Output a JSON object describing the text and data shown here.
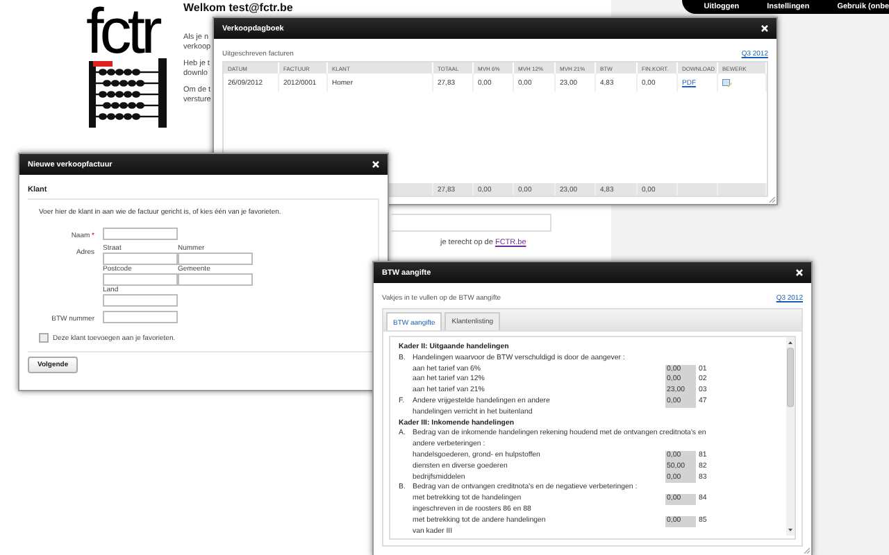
{
  "top_nav": [
    {
      "label": "Uitloggen"
    },
    {
      "label": "Instellingen"
    },
    {
      "label": "Gebruik (onbe"
    }
  ],
  "logo": {
    "text": "fctr"
  },
  "page": {
    "greeting": "Welkom test@fctr.be",
    "paragraphs": [
      [
        "Als je n",
        "verkoop"
      ],
      [
        "Heb je t",
        "downlo"
      ],
      [
        "Om de t",
        "versture"
      ]
    ],
    "footer_text": "je terecht op de",
    "footer_link": "FCTR.be"
  },
  "sales_journal": {
    "title": "Verkoopdagboek",
    "subtitle": "Uitgeschreven facturen",
    "period": "Q3 2012",
    "columns": [
      {
        "label": "DATUM",
        "kind": "text"
      },
      {
        "label": "FACTUUR",
        "kind": "text"
      },
      {
        "label": "KLANT",
        "kind": "text"
      },
      {
        "label": "TOTAAL",
        "kind": "amount"
      },
      {
        "label": "MVH 6%",
        "kind": "amount"
      },
      {
        "label": "MVH 12%",
        "kind": "amount"
      },
      {
        "label": "MVH 21%",
        "kind": "amount"
      },
      {
        "label": "BTW",
        "kind": "amount"
      },
      {
        "label": "FIN.KORT.",
        "kind": "amount"
      },
      {
        "label": "DOWNLOAD",
        "kind": "link"
      },
      {
        "label": "BEWERK",
        "kind": "action"
      }
    ],
    "rows": [
      {
        "cells": [
          "26/09/2012",
          "2012/0001",
          "Homer",
          "27,83",
          "0,00",
          "0,00",
          "23,00",
          "4,83",
          "0,00"
        ],
        "download": "PDF"
      }
    ],
    "totals": [
      "27,83",
      "0,00",
      "0,00",
      "23,00",
      "4,83",
      "0,00"
    ]
  },
  "new_invoice": {
    "title": "Nieuwe verkoopfactuur",
    "section": "Klant",
    "intro": "Voer hier de klant in aan wie de factuur gericht is, of kies één van je favorieten.",
    "name": {
      "label": "Naam",
      "required_mark": "*"
    },
    "address": {
      "label": "Adres",
      "fields": [
        {
          "label": "Straat"
        },
        {
          "label": "Nummer"
        },
        {
          "label": "Postcode"
        },
        {
          "label": "Gemeente"
        },
        {
          "label": "Land"
        }
      ]
    },
    "vat": {
      "label": "BTW nummer"
    },
    "favorite": {
      "label": "Deze klant toevoegen aan je favorieten.",
      "checked": false
    },
    "button": "Volgende"
  },
  "vat_return": {
    "title": "BTW aangifte",
    "intro": "Vakjes in te vullen op de BTW aangifte",
    "period": "Q3 2012",
    "tabs": [
      {
        "label": "BTW aangifte",
        "selected": true
      },
      {
        "label": "Klantenlisting",
        "selected": false
      }
    ],
    "rows": [
      {
        "kind": "heading",
        "lines": [
          "Kader II: Uitgaande handelingen"
        ]
      },
      {
        "kind": "group",
        "letter": "B.",
        "lines": [
          "Handelingen waarvoor de BTW verschuldigd is door de aangever :"
        ]
      },
      {
        "kind": "line",
        "lines": [
          "aan het tarief van 6%"
        ],
        "value": "0,00",
        "code": "01"
      },
      {
        "kind": "line",
        "lines": [
          "aan het tarief van 12%"
        ],
        "value": "0,00",
        "code": "02"
      },
      {
        "kind": "line",
        "lines": [
          "aan het tarief van 21%"
        ],
        "value": "23,00",
        "code": "03"
      },
      {
        "kind": "group",
        "letter": "F.",
        "lines": [
          "Andere vrijgestelde handelingen en andere",
          "handelingen verricht in het buitenland"
        ],
        "value": "0,00",
        "code": "47"
      },
      {
        "kind": "heading",
        "lines": [
          "Kader III: Inkomende handelingen"
        ]
      },
      {
        "kind": "group",
        "letter": "A.",
        "lines": [
          "Bedrag van de inkomende handelingen rekening houdend met de ontvangen creditnota's en",
          "andere verbeteringen :"
        ]
      },
      {
        "kind": "line",
        "lines": [
          "handelsgoederen, grond- en hulpstoffen"
        ],
        "value": "0,00",
        "code": "81"
      },
      {
        "kind": "line",
        "lines": [
          "diensten en diverse goederen"
        ],
        "value": "50,00",
        "code": "82"
      },
      {
        "kind": "line",
        "lines": [
          "bedrijfsmiddelen"
        ],
        "value": "0,00",
        "code": "83"
      },
      {
        "kind": "group",
        "letter": "B.",
        "lines": [
          "Bedrag van de ontvangen creditnota's en de negatieve verbeteringen :"
        ]
      },
      {
        "kind": "line",
        "lines": [
          "met betrekking tot de handelingen",
          "ingeschreven in de roosters 86 en 88"
        ],
        "value": "0,00",
        "code": "84"
      },
      {
        "kind": "line",
        "lines": [
          "met betrekking tot de andere handelingen",
          "van kader III"
        ],
        "value": "0,00",
        "code": "85"
      }
    ]
  }
}
